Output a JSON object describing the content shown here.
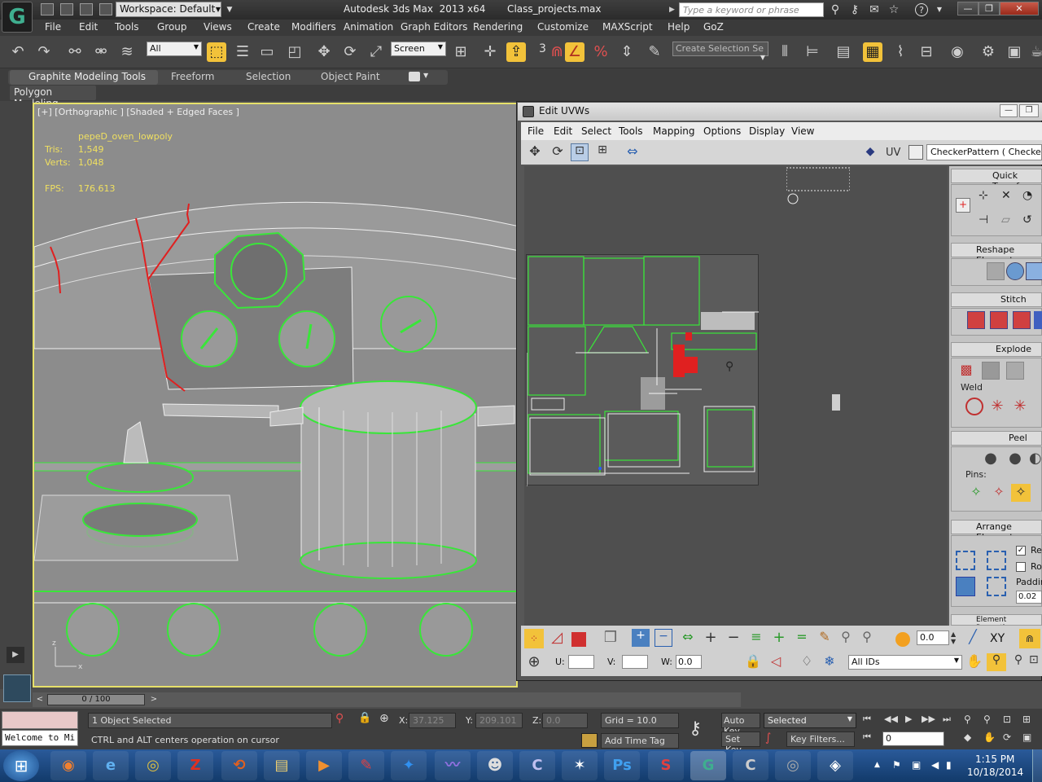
{
  "titlebar": {
    "workspace": "Workspace: Default",
    "title": "Autodesk 3ds Max  2013 x64       Class_projects.max",
    "search_placeholder": "Type a keyword or phrase",
    "logo": "G"
  },
  "menubar": [
    "File",
    "Edit",
    "Tools",
    "Group",
    "Views",
    "Create",
    "Modifiers",
    "Animation",
    "Graph Editors",
    "Rendering",
    "Customize",
    "MAXScript",
    "Help",
    "GoZ"
  ],
  "toolbar": {
    "filter": "All",
    "coord_system": "Screen",
    "selection_set_placeholder": "Create Selection Se",
    "snap_number": "3"
  },
  "ribbon": {
    "tabs": [
      "Graphite Modeling Tools",
      "Freeform",
      "Selection",
      "Object Paint"
    ],
    "panel": "Polygon Modeling"
  },
  "viewport": {
    "label": "[+] [Orthographic ] [Shaded + Edged Faces ]",
    "object_name": "pepeD_oven_lowpoly",
    "tris_label": "Tris:",
    "tris": "1,549",
    "verts_label": "Verts:",
    "verts": "1,048",
    "fps_label": "FPS:",
    "fps": "176.613"
  },
  "uv_editor": {
    "title": "Edit UVWs",
    "menus": [
      "File",
      "Edit",
      "Select",
      "Tools",
      "Mapping",
      "Options",
      "Display",
      "View"
    ],
    "uv_label": "UV",
    "texture": "CheckerPattern  ( Checker )",
    "rollouts": [
      "Quick Transform",
      "Reshape Elements",
      "Stitch",
      "Explode",
      "Peel",
      "Arrange Elements",
      "Element Properties"
    ],
    "weld_label": "Weld",
    "pins_label": "Pins:",
    "padding_label": "Paddin",
    "padding_value": "0.02",
    "rescale_label": "Re",
    "rotate_label": "Ro",
    "soft_value": "0.0",
    "xy_label": "XY",
    "u_label": "U:",
    "v_label": "V:",
    "w_label": "W:",
    "w_value": "0.0",
    "ids": "All IDs"
  },
  "timeline": {
    "frame": "0 / 100"
  },
  "status": {
    "maxscript": "Welcome to Mi",
    "selection": "1 Object Selected",
    "prompt": "CTRL and ALT centers operation on cursor",
    "x_label": "X:",
    "x": "37.125",
    "y_label": "Y:",
    "y": "209.101",
    "z_label": "Z:",
    "z": "0.0",
    "grid": "Grid = 10.0",
    "add_time_tag": "Add Time Tag",
    "auto_key": "Auto Key",
    "set_key": "Set Key",
    "key_mode": "Selected",
    "key_filters": "Key Filters...",
    "current_frame": "0"
  },
  "taskbar": {
    "time": "1:15 PM",
    "date": "10/18/2014"
  },
  "colors": {
    "viewport_border": "#e6e06a",
    "selection_green": "#39e639",
    "selected_red": "#e02020"
  }
}
